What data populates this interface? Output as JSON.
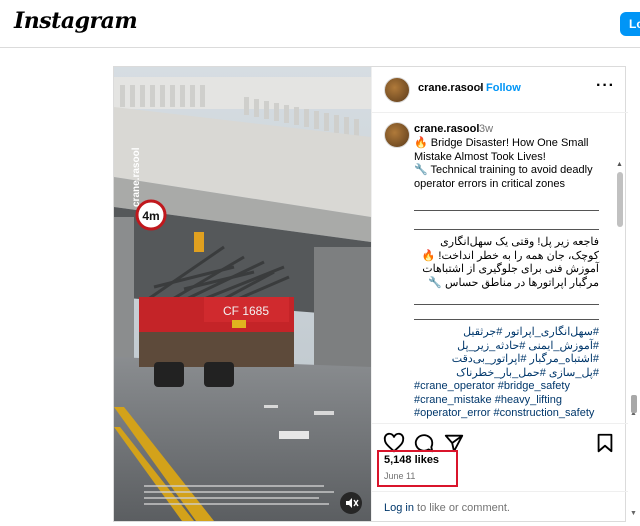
{
  "app": {
    "logo": "Instagram",
    "login_label": "Lo"
  },
  "post": {
    "username": "crane.rasool",
    "separator": "•",
    "follow_label": "Follow",
    "more_label": "···",
    "caption": {
      "username": "crane.rasool",
      "time": "3w",
      "en_line1": "🔥 Bridge Disaster! How One Small Mistake Almost Took Lives!",
      "en_line2": "🔧 Technical training to avoid deadly operator errors in critical zones",
      "fa_line1": "فاجعه زیر پل! وقتی یک سهل‌انگاری کوچک، جان همه را به خطر انداخت! 🔥",
      "fa_line2": "آموزش فنی برای جلوگیری از اشتباهات مرگبار اپراتورها در مناطق حساس 🔧",
      "tags_fa": "#سهل‌انگاری_اپراتور #جرثقیل #آموزش_ایمنی #حادثه_زیر_پل #اشتباه_مرگبار #اپراتور_بی‌دقت #پل_سازی #حمل_بار_خطرناک",
      "tags_en": "#crane_operator #bridge_safety #crane_mistake #heavy_lifting #operator_error #construction_safety #lift_training"
    },
    "media": {
      "watermark": "crane.rasool",
      "sign_text": "4m",
      "plate_text": "CF 1685",
      "mute_icon": "mute-icon"
    },
    "likes": "5,148 likes",
    "date": "June 11",
    "login_prompt": {
      "link": "Log in",
      "rest": " to like or comment."
    },
    "highlight_color": "#d9142b"
  }
}
